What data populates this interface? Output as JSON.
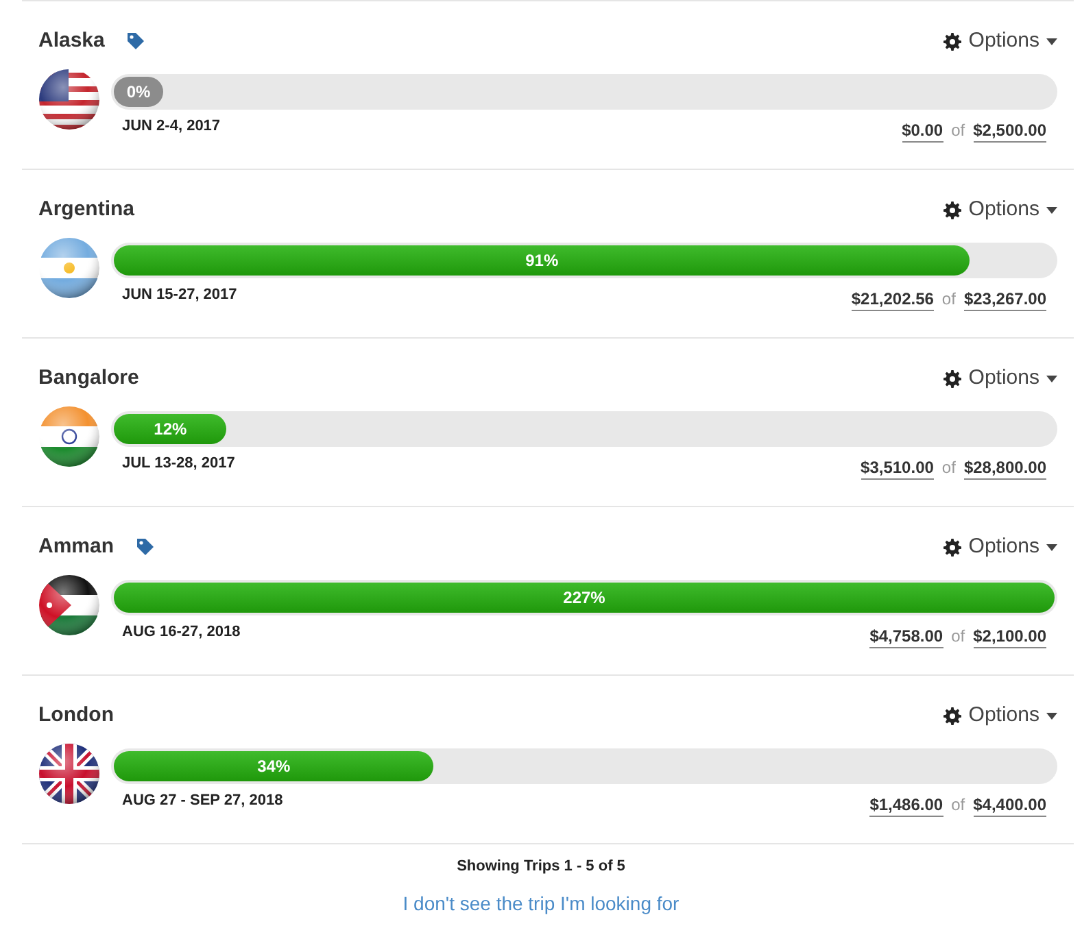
{
  "trips": [
    {
      "name": "Alaska",
      "tagged": true,
      "kind": "us",
      "level": 0,
      "percent": "0%",
      "dates": "JUN 2-4, 2017",
      "raised": "$0.00",
      "of": "of",
      "goal": "$2,500.00",
      "options": "Options"
    },
    {
      "name": "Argentina",
      "tagged": false,
      "kind": "ar",
      "level": 0.91,
      "percent": "91%",
      "dates": "JUN 15-27, 2017",
      "raised": "$21,202.56",
      "of": "of",
      "goal": "$23,267.00",
      "options": "Options"
    },
    {
      "name": "Bangalore",
      "tagged": false,
      "kind": "in",
      "level": 0.12,
      "percent": "12%",
      "dates": "JUL 13-28, 2017",
      "raised": "$3,510.00",
      "of": "of",
      "goal": "$28,800.00",
      "options": "Options"
    },
    {
      "name": "Amman",
      "tagged": true,
      "kind": "jo",
      "level": 1,
      "percent": "227%",
      "dates": "AUG 16-27, 2018",
      "raised": "$4,758.00",
      "of": "of",
      "goal": "$2,100.00",
      "options": "Options"
    },
    {
      "name": "London",
      "tagged": false,
      "kind": "gb",
      "level": 0.34,
      "percent": "34%",
      "dates": "AUG 27 - SEP 27, 2018",
      "raised": "$1,486.00",
      "of": "of",
      "goal": "$4,400.00",
      "options": "Options"
    }
  ],
  "summary": "Showing Trips 1 - 5 of 5",
  "help_link": "I don't see the trip I'm looking for"
}
